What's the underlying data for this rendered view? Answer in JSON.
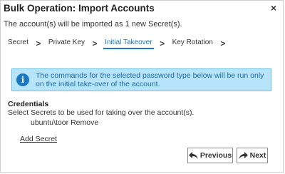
{
  "dialog": {
    "title": "Bulk Operation: Import Accounts",
    "close_glyph": "×",
    "subtitle": "The account(s) will be imported as 1 new Secret(s)."
  },
  "wizard": {
    "steps": [
      {
        "label": "Secret"
      },
      {
        "label": "Private Key"
      },
      {
        "label": "Initial Takeover",
        "active": true
      },
      {
        "label": "Key Rotation"
      }
    ],
    "separator_glyph": "›"
  },
  "info": {
    "icon": "info-icon",
    "icon_glyph": "i",
    "message": "The commands for the selected password type below will be run only on the initial take-over of the account."
  },
  "credentials": {
    "heading": "Credentials",
    "description": "Select Secrets to be used for taking over the account(s).",
    "secrets": [
      {
        "name": "ubuntu\\toor",
        "remove_label": "Remove"
      }
    ],
    "add_label": "Add Secret"
  },
  "footer": {
    "previous_label": "Previous",
    "next_label": "Next",
    "previous_icon": "share-back-icon",
    "next_icon": "share-forward-icon"
  },
  "colors": {
    "accent": "#1a78c2",
    "info_background": "#b7e4f8",
    "info_border": "#6bc0e8",
    "info_text": "#1a6aa8"
  }
}
